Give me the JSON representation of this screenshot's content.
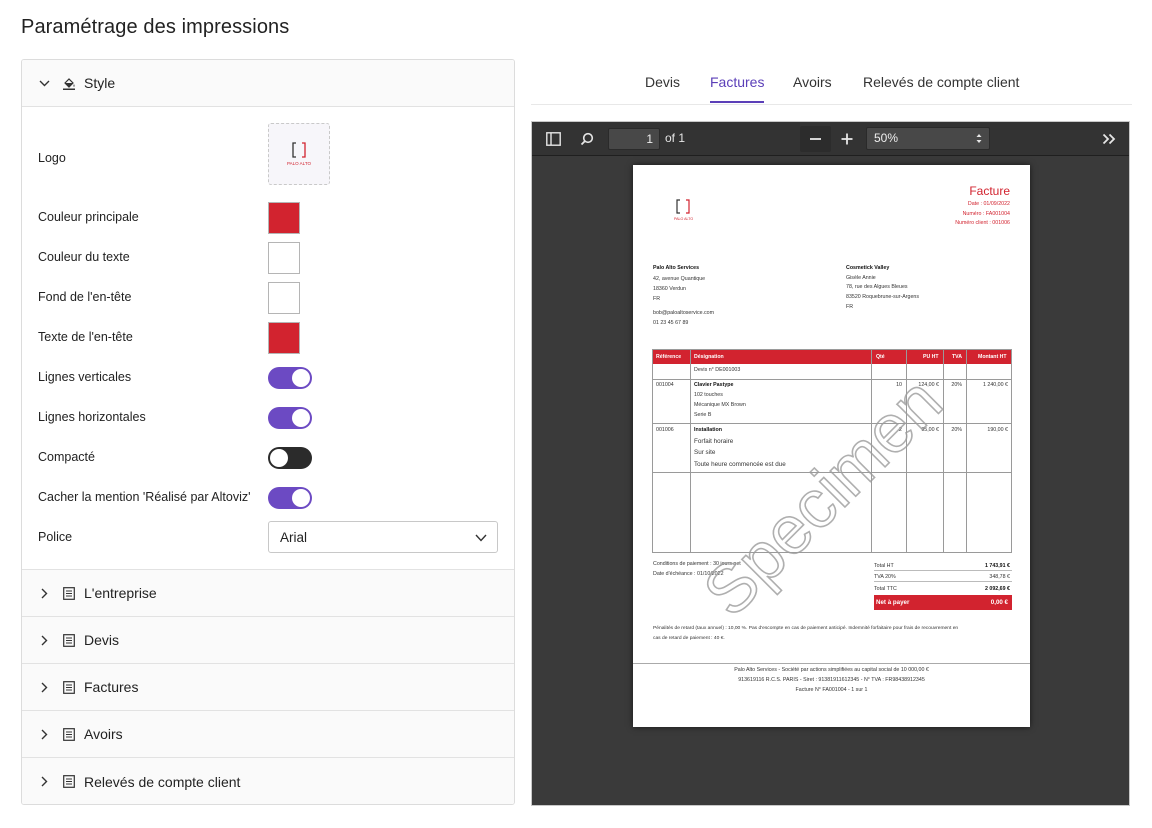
{
  "page": {
    "title": "Paramétrage des impressions"
  },
  "style_section": {
    "header": "Style",
    "logo_label": "Logo",
    "logo_text": "PALO ALTO",
    "fields": [
      {
        "label": "Couleur principale",
        "type": "color",
        "value": "#d2232f"
      },
      {
        "label": "Couleur du texte",
        "type": "color",
        "value": "#ffffff"
      },
      {
        "label": "Fond de l'en-tête",
        "type": "color",
        "value": "#ffffff"
      },
      {
        "label": "Texte de l'en-tête",
        "type": "color",
        "value": "#d2232f"
      },
      {
        "label": "Lignes verticales",
        "type": "toggle",
        "value": true
      },
      {
        "label": "Lignes horizontales",
        "type": "toggle",
        "value": true
      },
      {
        "label": "Compacté",
        "type": "toggle",
        "value": false
      },
      {
        "label": "Cacher la mention 'Réalisé par Altoviz'",
        "type": "toggle",
        "value": true
      }
    ],
    "font_label": "Police",
    "font_value": "Arial"
  },
  "sections": [
    {
      "label": "L'entreprise",
      "icon": "list-icon"
    },
    {
      "label": "Devis",
      "icon": "list-icon"
    },
    {
      "label": "Factures",
      "icon": "list-icon"
    },
    {
      "label": "Avoirs",
      "icon": "list-icon"
    },
    {
      "label": "Relevés de compte client",
      "icon": "list-icon"
    }
  ],
  "tabs": [
    {
      "label": "Devis",
      "active": false
    },
    {
      "label": "Factures",
      "active": true
    },
    {
      "label": "Avoirs",
      "active": false
    },
    {
      "label": "Relevés de compte client",
      "active": false
    }
  ],
  "viewer": {
    "page_number": "1",
    "page_of": "of 1",
    "zoom": "50%"
  },
  "invoice": {
    "title": "Facture",
    "date": "Date : 01/09/2022",
    "number": "Numéro : FA001004",
    "client_number": "Numéro client : 001006",
    "logo_text": "PALO ALTO",
    "sender": {
      "name": "Palo Alto Services",
      "address1": "42, avenue Quantique",
      "address2": "18360 Verdun",
      "country": "FR",
      "email": "bob@paloaltoservice.com",
      "phone": "01 23 45 67 89"
    },
    "client": {
      "name": "Cosmetick Valley",
      "contact": "Gisèle Annie",
      "address1": "78, rue des Algues Bleues",
      "address2": "83520 Roquebrune-sur-Argens",
      "country": "FR"
    },
    "columns": [
      "Référence",
      "Désignation",
      "Qté",
      "PU HT",
      "TVA",
      "Montant HT"
    ],
    "quote_ref": "Devis n° DE001003",
    "lines": [
      {
        "ref": "001004",
        "title": "Clavier Pastype",
        "details": [
          "102 touches",
          "Mécanique MX Brown",
          "Serie B"
        ],
        "qty": "10",
        "unit": "124,00 €",
        "vat": "20%",
        "amount": "1 240,00 €"
      },
      {
        "ref": "001006",
        "title": "Installation",
        "details": [
          "Forfait horaire",
          "Sur site",
          "Toute heure commencée est due"
        ],
        "qty": "2",
        "unit": "95,00 €",
        "vat": "20%",
        "amount": "190,00 €"
      }
    ],
    "conditions": "Conditions de paiement : 30 jours net",
    "due_date": "Date d'échéance : 01/10/2022",
    "totals": [
      {
        "label": "Total HT",
        "value": "1 743,91 €"
      },
      {
        "label": "TVA 20%",
        "value": "348,78 €"
      },
      {
        "label": "Total TTC",
        "value": "2 092,69 €"
      }
    ],
    "net_label": "Net à payer",
    "net_value": "0,00 €",
    "penalties_1": "Pénalités de retard (taux annuel) : 10,00 %. Pas d'escompte en cas de paiement anticipé. Indemnité forfaitaire pour frais de recouvrement en",
    "penalties_2": "cas de retard de paiement : 40 €.",
    "footer_1": "Palo Alto Services - Société par actions simplifiées au capital social de 10 000,00 €",
    "footer_2": "913619116 R.C.S. PARIS - Siret : 91381911612345 - N° TVA : FR98438912345",
    "footer_3": "Facture N° FA001004 - 1 sur 1",
    "watermark": "Specimen"
  }
}
